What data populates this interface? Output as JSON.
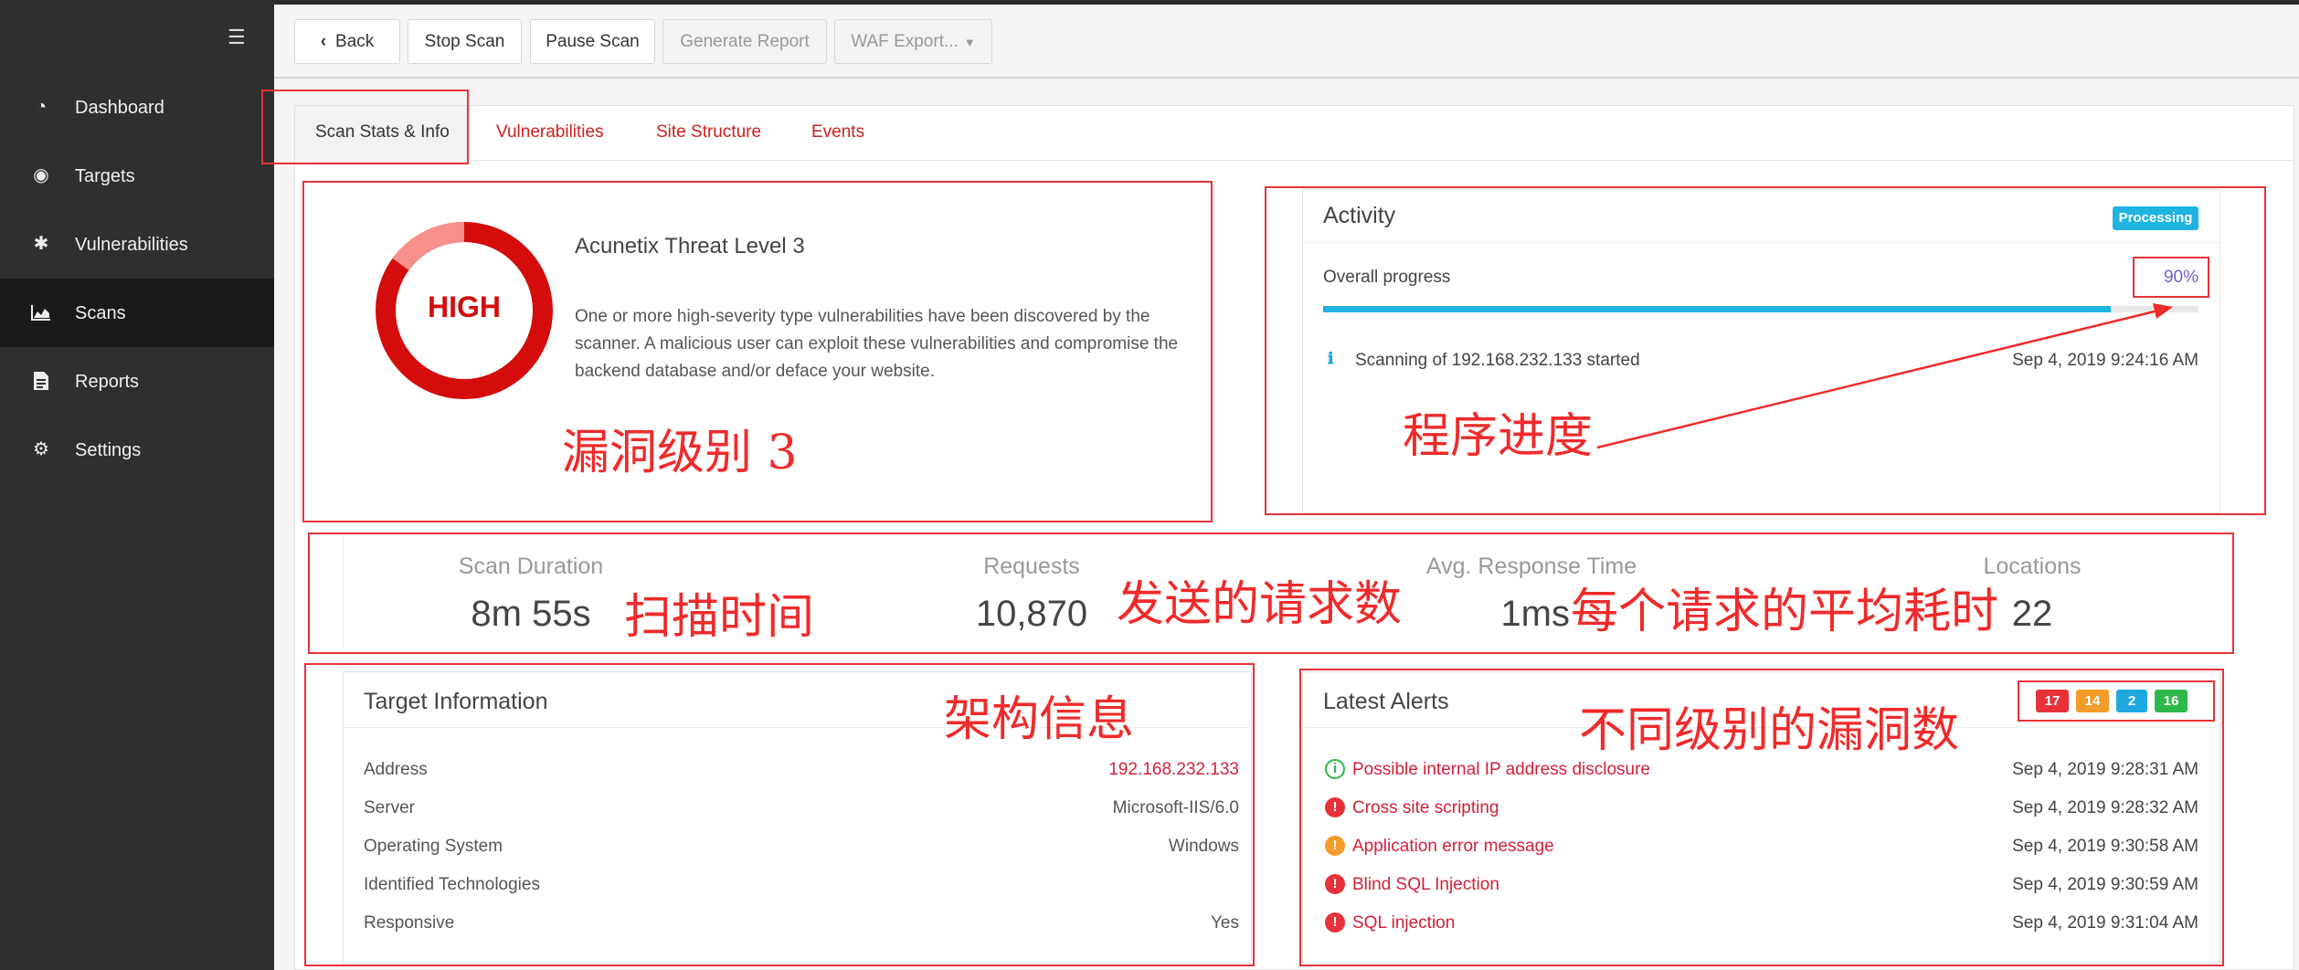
{
  "sidebar": {
    "items": [
      {
        "label": "Dashboard",
        "icon": "dashboard-icon",
        "active": false
      },
      {
        "label": "Targets",
        "icon": "target-icon",
        "active": false
      },
      {
        "label": "Vulnerabilities",
        "icon": "bug-icon",
        "active": false
      },
      {
        "label": "Scans",
        "icon": "area-chart-icon",
        "active": true
      },
      {
        "label": "Reports",
        "icon": "file-icon",
        "active": false
      },
      {
        "label": "Settings",
        "icon": "gear-icon",
        "active": false
      }
    ]
  },
  "toolbar": {
    "back_label": "Back",
    "stop_label": "Stop Scan",
    "pause_label": "Pause Scan",
    "report_label": "Generate Report",
    "waf_label": "WAF Export..."
  },
  "tabs": {
    "stats": "Scan Stats & Info",
    "vulns": "Vulnerabilities",
    "site": "Site Structure",
    "events": "Events"
  },
  "threat": {
    "level_text": "HIGH",
    "title": "Acunetix Threat Level 3",
    "desc_line1": "One or more high-severity type vulnerabilities have been discovered by the",
    "desc_line2": "scanner. A malicious user can exploit these vulnerabilities and compromise the",
    "desc_line3": "backend database and/or deface your website."
  },
  "activity": {
    "title": "Activity",
    "status_badge": "Processing",
    "progress_label": "Overall progress",
    "progress_text": "90%",
    "progress_fraction": 0.9,
    "event_text": "Scanning of 192.168.232.133 started",
    "event_time": "Sep 4, 2019 9:24:16 AM"
  },
  "stats": {
    "duration_label": "Scan Duration",
    "duration_value": "8m 55s",
    "requests_label": "Requests",
    "requests_value": "10,870",
    "resp_label": "Avg. Response Time",
    "resp_value": "1ms",
    "locations_label": "Locations",
    "locations_value": "22"
  },
  "target": {
    "title": "Target Information",
    "rows": [
      {
        "key": "Address",
        "value": "192.168.232.133"
      },
      {
        "key": "Server",
        "value": "Microsoft-IIS/6.0"
      },
      {
        "key": "Operating System",
        "value": "Windows"
      },
      {
        "key": "Identified Technologies",
        "value": ""
      },
      {
        "key": "Responsive",
        "value": "Yes"
      }
    ]
  },
  "alerts": {
    "title": "Latest Alerts",
    "counts": {
      "high": "17",
      "medium": "14",
      "low": "2",
      "info": "16"
    },
    "colors": {
      "high": "#e8323a",
      "medium": "#f39c2b",
      "low": "#1fa8e0",
      "info": "#2fb84a"
    },
    "items": [
      {
        "title": "Possible internal IP address disclosure",
        "time": "Sep 4, 2019 9:28:31 AM",
        "severity": "info"
      },
      {
        "title": "Cross site scripting",
        "time": "Sep 4, 2019 9:28:32 AM",
        "severity": "high"
      },
      {
        "title": "Application error message",
        "time": "Sep 4, 2019 9:30:58 AM",
        "severity": "medium"
      },
      {
        "title": "Blind SQL Injection",
        "time": "Sep 4, 2019 9:30:59 AM",
        "severity": "high"
      },
      {
        "title": "SQL injection",
        "time": "Sep 4, 2019 9:31:04 AM",
        "severity": "high"
      }
    ]
  },
  "annotations": {
    "threat": "漏洞级别 3",
    "progress": "程序进度",
    "duration": "扫描时间",
    "requests": "发送的请求数",
    "resp": "每个请求的平均耗时",
    "target": "架构信息",
    "alerts": "不同级别的漏洞数"
  }
}
